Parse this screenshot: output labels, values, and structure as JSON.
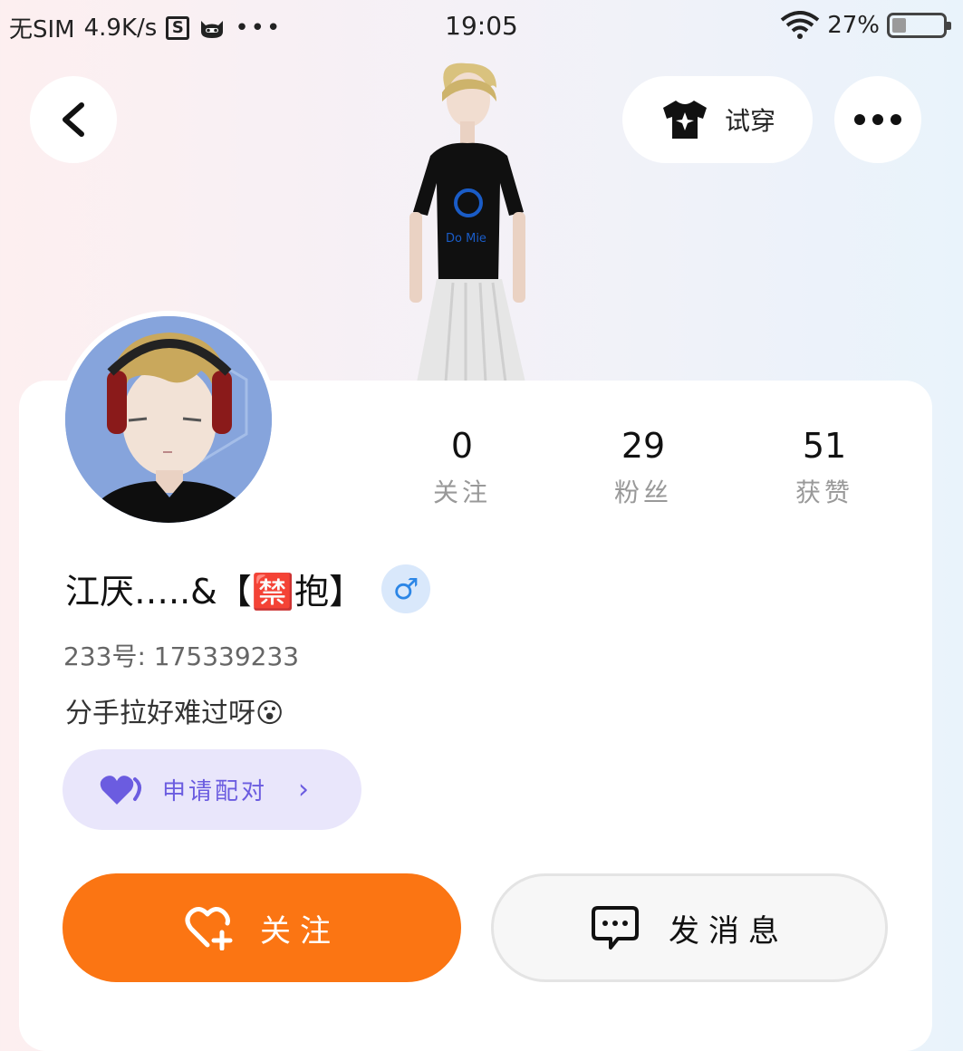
{
  "status_bar": {
    "sim": "无SIM",
    "speed": "4.9K/s",
    "s_icon": "S",
    "more": "•••",
    "time": "19:05",
    "battery_text": "27%",
    "battery_level": 0.27
  },
  "top_bar": {
    "back_icon": "chevron-left-icon",
    "try_on_label": "试穿",
    "more_icon": "more-dots-icon"
  },
  "stats": [
    {
      "value": "0",
      "label": "关注"
    },
    {
      "value": "29",
      "label": "粉丝"
    },
    {
      "value": "51",
      "label": "获赞"
    }
  ],
  "profile": {
    "name": "江厌…..&【🈲抱】",
    "gender_symbol": "♂",
    "uid": "233号: 175339233",
    "bio": "分手拉好难过呀😮"
  },
  "pair_button": {
    "label": "申请配对",
    "chevron": "›"
  },
  "actions": {
    "follow_label": "关注",
    "message_label": "发消息"
  },
  "colors": {
    "accent_orange": "#fb7513",
    "pair_purple": "#6b5ce0",
    "gender_blue": "#2c86e6"
  }
}
